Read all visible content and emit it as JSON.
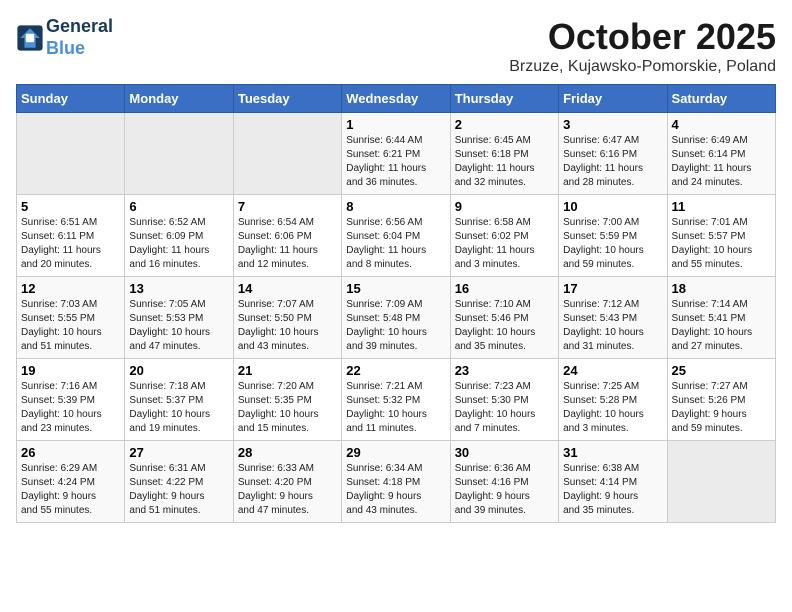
{
  "header": {
    "logo_line1": "General",
    "logo_line2": "Blue",
    "month": "October 2025",
    "location": "Brzuze, Kujawsko-Pomorskie, Poland"
  },
  "days_of_week": [
    "Sunday",
    "Monday",
    "Tuesday",
    "Wednesday",
    "Thursday",
    "Friday",
    "Saturday"
  ],
  "weeks": [
    [
      {
        "day": "",
        "info": ""
      },
      {
        "day": "",
        "info": ""
      },
      {
        "day": "",
        "info": ""
      },
      {
        "day": "1",
        "info": "Sunrise: 6:44 AM\nSunset: 6:21 PM\nDaylight: 11 hours\nand 36 minutes."
      },
      {
        "day": "2",
        "info": "Sunrise: 6:45 AM\nSunset: 6:18 PM\nDaylight: 11 hours\nand 32 minutes."
      },
      {
        "day": "3",
        "info": "Sunrise: 6:47 AM\nSunset: 6:16 PM\nDaylight: 11 hours\nand 28 minutes."
      },
      {
        "day": "4",
        "info": "Sunrise: 6:49 AM\nSunset: 6:14 PM\nDaylight: 11 hours\nand 24 minutes."
      }
    ],
    [
      {
        "day": "5",
        "info": "Sunrise: 6:51 AM\nSunset: 6:11 PM\nDaylight: 11 hours\nand 20 minutes."
      },
      {
        "day": "6",
        "info": "Sunrise: 6:52 AM\nSunset: 6:09 PM\nDaylight: 11 hours\nand 16 minutes."
      },
      {
        "day": "7",
        "info": "Sunrise: 6:54 AM\nSunset: 6:06 PM\nDaylight: 11 hours\nand 12 minutes."
      },
      {
        "day": "8",
        "info": "Sunrise: 6:56 AM\nSunset: 6:04 PM\nDaylight: 11 hours\nand 8 minutes."
      },
      {
        "day": "9",
        "info": "Sunrise: 6:58 AM\nSunset: 6:02 PM\nDaylight: 11 hours\nand 3 minutes."
      },
      {
        "day": "10",
        "info": "Sunrise: 7:00 AM\nSunset: 5:59 PM\nDaylight: 10 hours\nand 59 minutes."
      },
      {
        "day": "11",
        "info": "Sunrise: 7:01 AM\nSunset: 5:57 PM\nDaylight: 10 hours\nand 55 minutes."
      }
    ],
    [
      {
        "day": "12",
        "info": "Sunrise: 7:03 AM\nSunset: 5:55 PM\nDaylight: 10 hours\nand 51 minutes."
      },
      {
        "day": "13",
        "info": "Sunrise: 7:05 AM\nSunset: 5:53 PM\nDaylight: 10 hours\nand 47 minutes."
      },
      {
        "day": "14",
        "info": "Sunrise: 7:07 AM\nSunset: 5:50 PM\nDaylight: 10 hours\nand 43 minutes."
      },
      {
        "day": "15",
        "info": "Sunrise: 7:09 AM\nSunset: 5:48 PM\nDaylight: 10 hours\nand 39 minutes."
      },
      {
        "day": "16",
        "info": "Sunrise: 7:10 AM\nSunset: 5:46 PM\nDaylight: 10 hours\nand 35 minutes."
      },
      {
        "day": "17",
        "info": "Sunrise: 7:12 AM\nSunset: 5:43 PM\nDaylight: 10 hours\nand 31 minutes."
      },
      {
        "day": "18",
        "info": "Sunrise: 7:14 AM\nSunset: 5:41 PM\nDaylight: 10 hours\nand 27 minutes."
      }
    ],
    [
      {
        "day": "19",
        "info": "Sunrise: 7:16 AM\nSunset: 5:39 PM\nDaylight: 10 hours\nand 23 minutes."
      },
      {
        "day": "20",
        "info": "Sunrise: 7:18 AM\nSunset: 5:37 PM\nDaylight: 10 hours\nand 19 minutes."
      },
      {
        "day": "21",
        "info": "Sunrise: 7:20 AM\nSunset: 5:35 PM\nDaylight: 10 hours\nand 15 minutes."
      },
      {
        "day": "22",
        "info": "Sunrise: 7:21 AM\nSunset: 5:32 PM\nDaylight: 10 hours\nand 11 minutes."
      },
      {
        "day": "23",
        "info": "Sunrise: 7:23 AM\nSunset: 5:30 PM\nDaylight: 10 hours\nand 7 minutes."
      },
      {
        "day": "24",
        "info": "Sunrise: 7:25 AM\nSunset: 5:28 PM\nDaylight: 10 hours\nand 3 minutes."
      },
      {
        "day": "25",
        "info": "Sunrise: 7:27 AM\nSunset: 5:26 PM\nDaylight: 9 hours\nand 59 minutes."
      }
    ],
    [
      {
        "day": "26",
        "info": "Sunrise: 6:29 AM\nSunset: 4:24 PM\nDaylight: 9 hours\nand 55 minutes."
      },
      {
        "day": "27",
        "info": "Sunrise: 6:31 AM\nSunset: 4:22 PM\nDaylight: 9 hours\nand 51 minutes."
      },
      {
        "day": "28",
        "info": "Sunrise: 6:33 AM\nSunset: 4:20 PM\nDaylight: 9 hours\nand 47 minutes."
      },
      {
        "day": "29",
        "info": "Sunrise: 6:34 AM\nSunset: 4:18 PM\nDaylight: 9 hours\nand 43 minutes."
      },
      {
        "day": "30",
        "info": "Sunrise: 6:36 AM\nSunset: 4:16 PM\nDaylight: 9 hours\nand 39 minutes."
      },
      {
        "day": "31",
        "info": "Sunrise: 6:38 AM\nSunset: 4:14 PM\nDaylight: 9 hours\nand 35 minutes."
      },
      {
        "day": "",
        "info": ""
      }
    ]
  ]
}
